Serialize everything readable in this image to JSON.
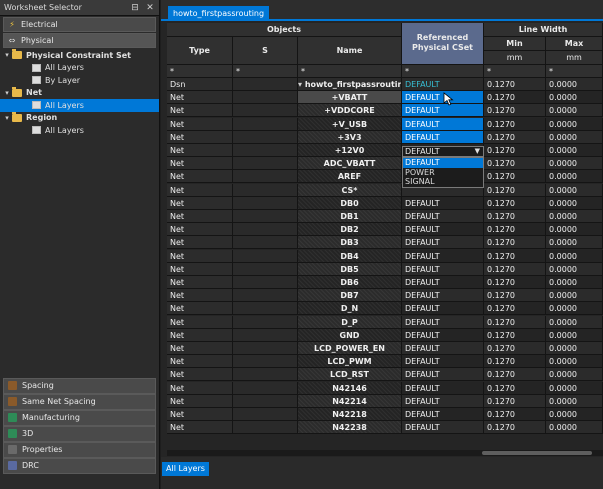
{
  "selector": {
    "title": "Worksheet Selector",
    "tabs": [
      {
        "label": "Electrical",
        "icon": "electrical-icon"
      },
      {
        "label": "Physical",
        "icon": "physical-icon"
      }
    ],
    "tree": [
      {
        "label": "Physical Constraint Set",
        "bold": true,
        "indent": 0,
        "expand": "▾",
        "icon": "folder"
      },
      {
        "label": "All Layers",
        "bold": false,
        "indent": 1,
        "expand": "",
        "icon": "leaf"
      },
      {
        "label": "By Layer",
        "bold": false,
        "indent": 1,
        "expand": "",
        "icon": "leaf"
      },
      {
        "label": "Net",
        "bold": true,
        "indent": 0,
        "expand": "▾",
        "icon": "folder"
      },
      {
        "label": "All Layers",
        "bold": false,
        "indent": 1,
        "expand": "",
        "icon": "leaf",
        "selected": true
      },
      {
        "label": "Region",
        "bold": true,
        "indent": 0,
        "expand": "▾",
        "icon": "folder"
      },
      {
        "label": "All Layers",
        "bold": false,
        "indent": 1,
        "expand": "",
        "icon": "leaf"
      }
    ],
    "bottom": [
      {
        "label": "Spacing",
        "icon": "spacing-icon",
        "color": "#8a5a2a"
      },
      {
        "label": "Same Net Spacing",
        "icon": "same-net-spacing-icon",
        "color": "#8a5a2a"
      },
      {
        "label": "Manufacturing",
        "icon": "manufacturing-icon",
        "color": "#2e8b57"
      },
      {
        "label": "3D",
        "icon": "3d-icon",
        "color": "#2e8b57"
      },
      {
        "label": "Properties",
        "icon": "properties-icon",
        "color": "#6a6a6a"
      },
      {
        "label": "DRC",
        "icon": "drc-icon",
        "color": "#5a6aa0"
      }
    ]
  },
  "document_tab": "howto_firstpassrouting",
  "headers": {
    "objects": "Objects",
    "type": "Type",
    "s": "S",
    "name": "Name",
    "cset": "Referenced Physical CSet",
    "line_width": "Line Width",
    "min": "Min",
    "max": "Max",
    "unit_min": "mm",
    "unit_max": "mm",
    "filter": "*"
  },
  "rows": [
    {
      "type": "Dsn",
      "name": "howto_firstpassrouting",
      "cset": "DEFAULT",
      "min": "0.1270",
      "max": "0.0000",
      "dsn": true
    },
    {
      "type": "Net",
      "name": "+VBATT",
      "cset": "DEFAULT",
      "min": "0.1270",
      "max": "0.0000",
      "cset_sel": true,
      "name_sel": true
    },
    {
      "type": "Net",
      "name": "+VDDCORE",
      "cset": "DEFAULT",
      "min": "0.1270",
      "max": "0.0000",
      "cset_sel": true
    },
    {
      "type": "Net",
      "name": "+V_USB",
      "cset": "DEFAULT",
      "min": "0.1270",
      "max": "0.0000",
      "cset_sel": true
    },
    {
      "type": "Net",
      "name": "+3V3",
      "cset": "DEFAULT",
      "min": "0.1270",
      "max": "0.0000",
      "cset_sel": true
    },
    {
      "type": "Net",
      "name": "+12V0",
      "cset": "",
      "min": "0.1270",
      "max": "0.0000"
    },
    {
      "type": "Net",
      "name": "ADC_VBATT",
      "cset": "",
      "min": "0.1270",
      "max": "0.0000"
    },
    {
      "type": "Net",
      "name": "AREF",
      "cset": "",
      "min": "0.1270",
      "max": "0.0000"
    },
    {
      "type": "Net",
      "name": "CS*",
      "cset": "",
      "min": "0.1270",
      "max": "0.0000"
    },
    {
      "type": "Net",
      "name": "DB0",
      "cset": "DEFAULT",
      "min": "0.1270",
      "max": "0.0000"
    },
    {
      "type": "Net",
      "name": "DB1",
      "cset": "DEFAULT",
      "min": "0.1270",
      "max": "0.0000"
    },
    {
      "type": "Net",
      "name": "DB2",
      "cset": "DEFAULT",
      "min": "0.1270",
      "max": "0.0000"
    },
    {
      "type": "Net",
      "name": "DB3",
      "cset": "DEFAULT",
      "min": "0.1270",
      "max": "0.0000"
    },
    {
      "type": "Net",
      "name": "DB4",
      "cset": "DEFAULT",
      "min": "0.1270",
      "max": "0.0000"
    },
    {
      "type": "Net",
      "name": "DB5",
      "cset": "DEFAULT",
      "min": "0.1270",
      "max": "0.0000"
    },
    {
      "type": "Net",
      "name": "DB6",
      "cset": "DEFAULT",
      "min": "0.1270",
      "max": "0.0000"
    },
    {
      "type": "Net",
      "name": "DB7",
      "cset": "DEFAULT",
      "min": "0.1270",
      "max": "0.0000"
    },
    {
      "type": "Net",
      "name": "D_N",
      "cset": "DEFAULT",
      "min": "0.1270",
      "max": "0.0000"
    },
    {
      "type": "Net",
      "name": "D_P",
      "cset": "DEFAULT",
      "min": "0.1270",
      "max": "0.0000"
    },
    {
      "type": "Net",
      "name": "GND",
      "cset": "DEFAULT",
      "min": "0.1270",
      "max": "0.0000"
    },
    {
      "type": "Net",
      "name": "LCD_POWER_EN",
      "cset": "DEFAULT",
      "min": "0.1270",
      "max": "0.0000"
    },
    {
      "type": "Net",
      "name": "LCD_PWM",
      "cset": "DEFAULT",
      "min": "0.1270",
      "max": "0.0000"
    },
    {
      "type": "Net",
      "name": "LCD_RST",
      "cset": "DEFAULT",
      "min": "0.1270",
      "max": "0.0000"
    },
    {
      "type": "Net",
      "name": "N42146",
      "cset": "DEFAULT",
      "min": "0.1270",
      "max": "0.0000"
    },
    {
      "type": "Net",
      "name": "N42214",
      "cset": "DEFAULT",
      "min": "0.1270",
      "max": "0.0000"
    },
    {
      "type": "Net",
      "name": "N42218",
      "cset": "DEFAULT",
      "min": "0.1270",
      "max": "0.0000"
    },
    {
      "type": "Net",
      "name": "N42238",
      "cset": "DEFAULT",
      "min": "0.1270",
      "max": "0.0000"
    }
  ],
  "dropdown": {
    "value": "DEFAULT",
    "options": [
      "DEFAULT",
      "POWER",
      "SIGNAL"
    ],
    "selected": "DEFAULT"
  },
  "footer_tab": "All Layers"
}
